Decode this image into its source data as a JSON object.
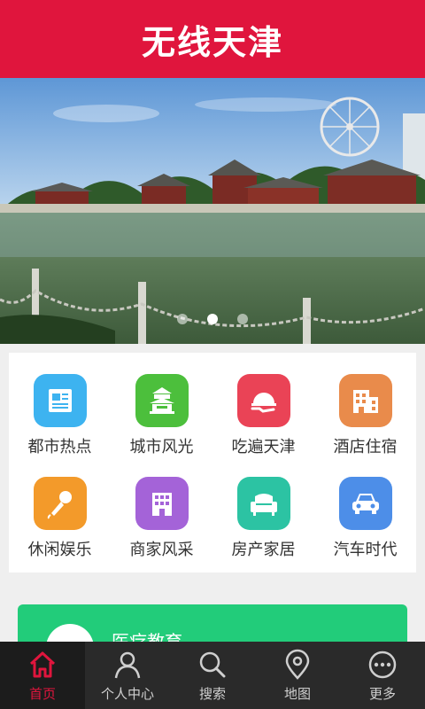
{
  "header": {
    "title": "无线天津",
    "bg_color": "#e0153d"
  },
  "banner": {
    "slide_count": 3,
    "active_slide": 2
  },
  "grid": [
    {
      "label": "都市热点",
      "icon": "newspaper-icon",
      "color": "#3db3f0"
    },
    {
      "label": "城市风光",
      "icon": "temple-icon",
      "color": "#4cbf3c"
    },
    {
      "label": "吃遍天津",
      "icon": "food-plate-icon",
      "color": "#ea4356"
    },
    {
      "label": "酒店住宿",
      "icon": "hotel-icon",
      "color": "#e98b4b"
    },
    {
      "label": "休闲娱乐",
      "icon": "microphone-icon",
      "color": "#f39a2a"
    },
    {
      "label": "商家风采",
      "icon": "building-icon",
      "color": "#a463d8"
    },
    {
      "label": "房产家居",
      "icon": "sofa-icon",
      "color": "#2cc3a3"
    },
    {
      "label": "汽车时代",
      "icon": "car-icon",
      "color": "#4d8ee8"
    }
  ],
  "card": {
    "label": "医疗教育",
    "color": "#22cc7a"
  },
  "tabbar": {
    "tabs": [
      {
        "label": "首页",
        "icon": "home-icon",
        "active": true
      },
      {
        "label": "个人中心",
        "icon": "person-icon",
        "active": false
      },
      {
        "label": "搜索",
        "icon": "search-icon",
        "active": false
      },
      {
        "label": "地图",
        "icon": "map-pin-icon",
        "active": false
      },
      {
        "label": "更多",
        "icon": "more-icon",
        "active": false
      }
    ],
    "active_color": "#e0153d"
  }
}
